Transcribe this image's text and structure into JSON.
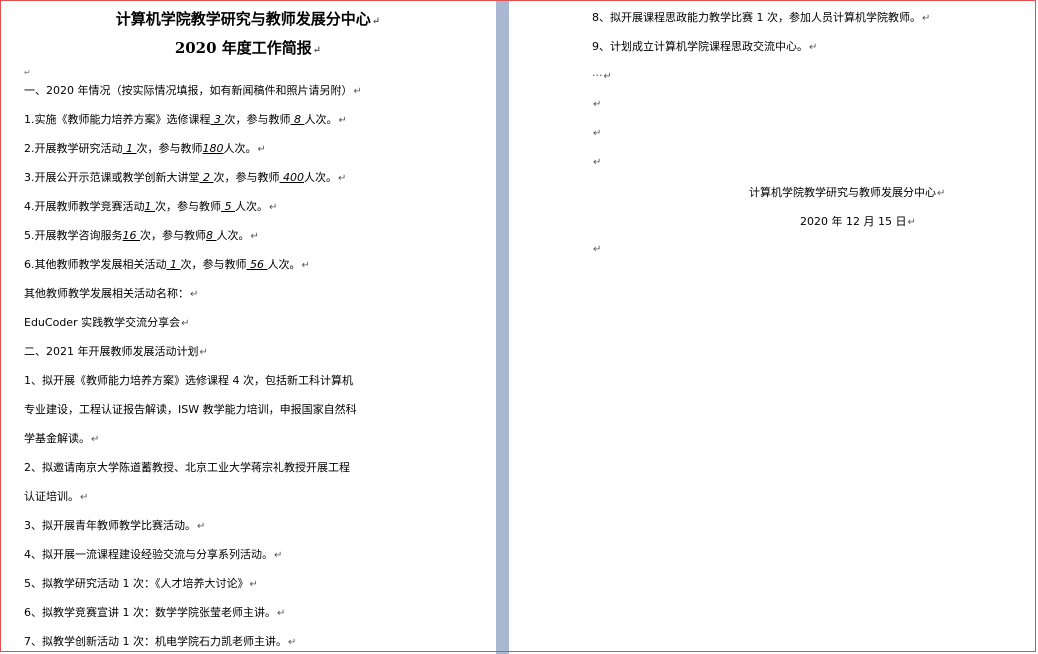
{
  "left_page": {
    "title_line1": "计算机学院教学研究与教师发展分中心",
    "title_line2": "2020 年度工作简报",
    "tiny_mark": "↵",
    "section1_heading": "一、2020 年情况（按实际情况填报，如有新闻稿件和照片请另附）",
    "items_2020": [
      {
        "pre": "1.实施《教师能力培养方案》选修课程",
        "v1": "  3  ",
        "mid": "次，参与教师",
        "v2": " 8 ",
        "post": "人次。"
      },
      {
        "pre": "2.开展教学研究活动",
        "v1": "  1  ",
        "mid": "次，参与教师",
        "v2": "180",
        "post": "人次。"
      },
      {
        "pre": "3.开展公开示范课或教学创新大讲堂",
        "v1": "   2 ",
        "mid": "次，参与教师",
        "v2": "  400",
        "post": "人次。"
      },
      {
        "pre": "4.开展教师教学竞赛活动",
        "v1": "1    ",
        "mid": "次，参与教师",
        "v2": "  5  ",
        "post": "人次。"
      },
      {
        "pre": "5.开展教学咨询服务",
        "v1": "16  ",
        "mid": "次，参与教师",
        "v2": "8   ",
        "post": "人次。"
      },
      {
        "pre": "6.其他教师教学发展相关活动",
        "v1": "   1 ",
        "mid": "次，参与教师",
        "v2": "   56 ",
        "post": "人次。"
      }
    ],
    "other_activity_label": "其他教师教学发展相关活动名称：",
    "other_activity_value": "EduCoder 实践教学交流分享会",
    "section2_heading": "二、2021 年开展教师发展活动计划",
    "plan_lines": [
      "1、拟开展《教师能力培养方案》选修课程 4 次，包括新工科计算机",
      "专业建设，工程认证报告解读，ISW 教学能力培训，申报国家自然科",
      "学基金解读。",
      "2、拟邀请南京大学陈道蓄教授、北京工业大学蒋宗礼教授开展工程",
      "认证培训。",
      "3、拟开展青年教师教学比赛活动。",
      "4、拟开展一流课程建设经验交流与分享系列活动。",
      "5、拟教学研究活动 1 次：《人才培养大讨论》",
      "6、拟教学竞赛宣讲 1 次：数学学院张莹老师主讲。",
      "7、拟教学创新活动 1 次：机电学院石力凯老师主讲。"
    ]
  },
  "right_page": {
    "plan_lines": [
      "8、拟开展课程思政能力教学比赛 1 次，参加人员计算机学院教师。",
      "9、计划成立计算机学院课程思政交流中心。"
    ],
    "dots": "···",
    "signature_org": "计算机学院教学研究与教师发展分中心",
    "signature_date": "2020 年 12 月 15 日"
  }
}
